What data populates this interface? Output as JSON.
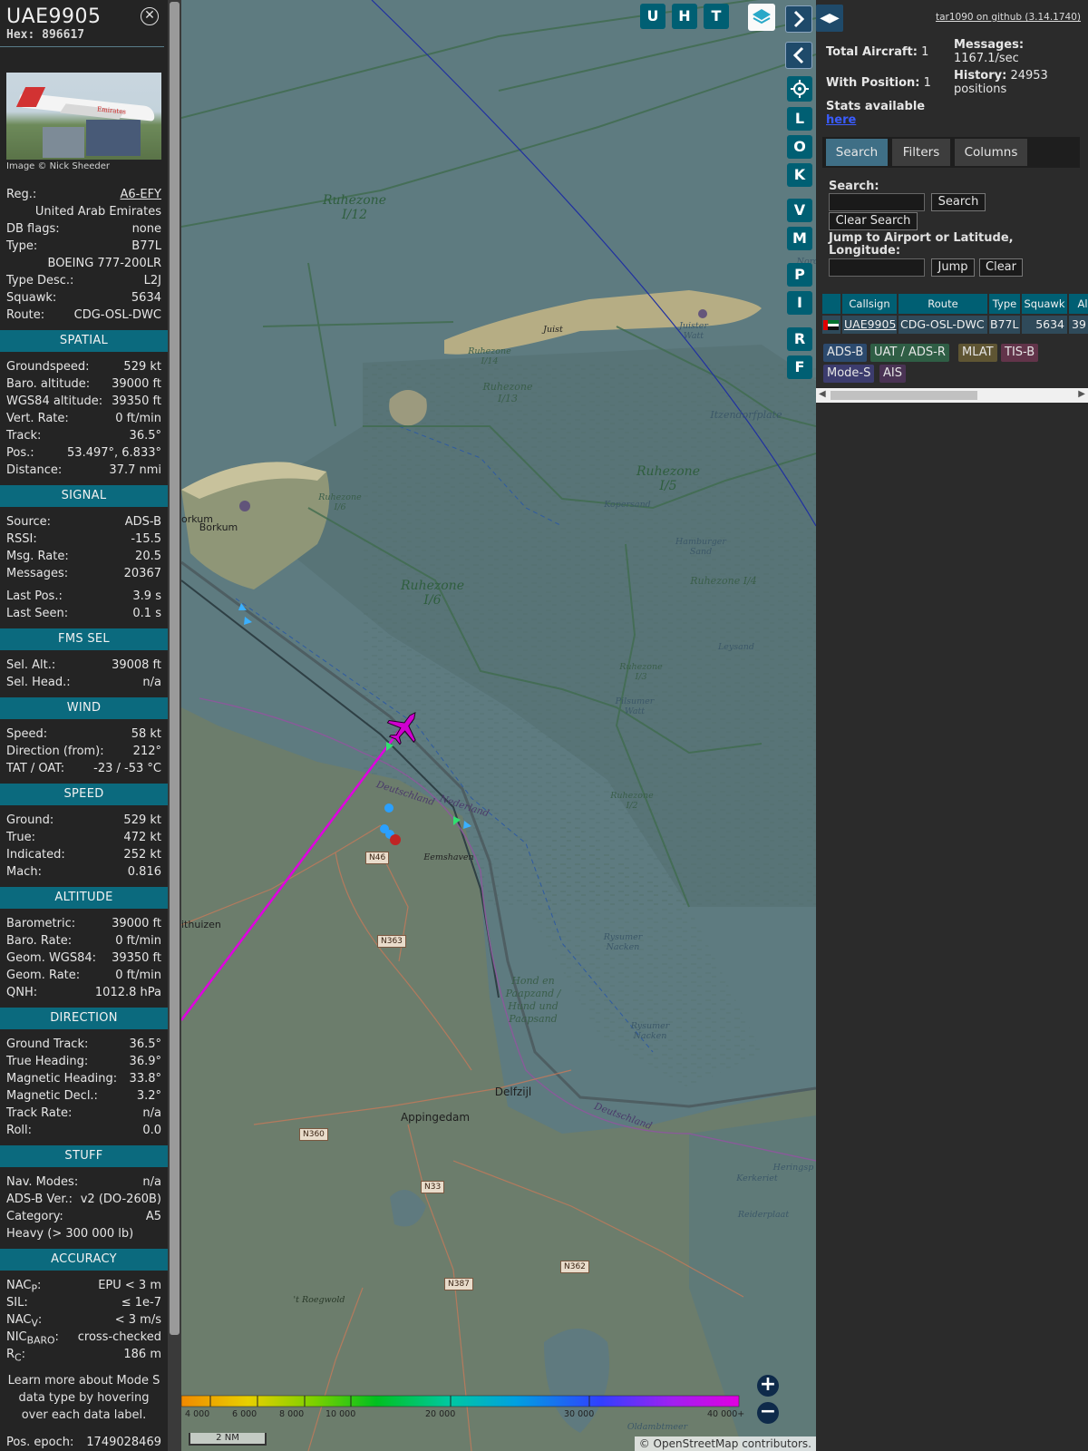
{
  "aircraft": {
    "callsign": "UAE9905",
    "hex": "Hex: 896617",
    "image_credit": "Image © Nick Sheeder",
    "livery_text": "Emirates"
  },
  "details": [
    {
      "label": "Reg.:",
      "value": "A6-EFY",
      "link": true
    },
    {
      "label": "",
      "value": "United Arab Emirates"
    },
    {
      "label": "DB flags:",
      "value": "none"
    },
    {
      "label": "Type:",
      "value": "B77L"
    },
    {
      "label": "",
      "value": "BOEING 777-200LR"
    },
    {
      "label": "Type Desc.:",
      "value": "L2J"
    },
    {
      "label": "Squawk:",
      "value": "5634"
    },
    {
      "label": "Route:",
      "value": "CDG-OSL-DWC"
    }
  ],
  "sections": [
    {
      "title": "SPATIAL",
      "rows": [
        {
          "label": "Groundspeed:",
          "value": "529 kt"
        },
        {
          "label": "Baro. altitude:",
          "value": "39000 ft"
        },
        {
          "label": "WGS84 altitude:",
          "value": "39350 ft"
        },
        {
          "label": "Vert. Rate:",
          "value": "0 ft/min"
        },
        {
          "label": "Track:",
          "value": "36.5°"
        },
        {
          "label": "Pos.:",
          "value": "53.497°, 6.833°"
        },
        {
          "label": "Distance:",
          "value": "37.7 nmi"
        }
      ]
    },
    {
      "title": "SIGNAL",
      "rows": [
        {
          "label": "Source:",
          "value": "ADS-B"
        },
        {
          "label": "RSSI:",
          "value": "-15.5"
        },
        {
          "label": "Msg. Rate:",
          "value": "20.5"
        },
        {
          "label": "Messages:",
          "value": "20367"
        },
        {
          "label": "Last Pos.:",
          "value": "3.9 s",
          "gap": true
        },
        {
          "label": "Last Seen:",
          "value": "0.1 s"
        }
      ]
    },
    {
      "title": "FMS SEL",
      "rows": [
        {
          "label": "Sel. Alt.:",
          "value": "39008 ft"
        },
        {
          "label": "Sel. Head.:",
          "value": "n/a"
        }
      ]
    },
    {
      "title": "WIND",
      "rows": [
        {
          "label": "Speed:",
          "value": "58 kt"
        },
        {
          "label": "Direction (from):",
          "value": "212°"
        },
        {
          "label": "TAT / OAT:",
          "value": "-23 / -53 °C"
        }
      ]
    },
    {
      "title": "SPEED",
      "rows": [
        {
          "label": "Ground:",
          "value": "529 kt"
        },
        {
          "label": "True:",
          "value": "472 kt"
        },
        {
          "label": "Indicated:",
          "value": "252 kt"
        },
        {
          "label": "Mach:",
          "value": "0.816"
        }
      ]
    },
    {
      "title": "ALTITUDE",
      "rows": [
        {
          "label": "Barometric:",
          "value": "39000 ft"
        },
        {
          "label": "Baro. Rate:",
          "value": "0 ft/min"
        },
        {
          "label": "Geom. WGS84:",
          "value": "39350 ft"
        },
        {
          "label": "Geom. Rate:",
          "value": "0 ft/min"
        },
        {
          "label": "QNH:",
          "value": "1012.8 hPa"
        }
      ]
    },
    {
      "title": "DIRECTION",
      "rows": [
        {
          "label": "Ground Track:",
          "value": "36.5°"
        },
        {
          "label": "True Heading:",
          "value": "36.9°"
        },
        {
          "label": "Magnetic Heading:",
          "value": "33.8°"
        },
        {
          "label": "Magnetic Decl.:",
          "value": "3.2°"
        },
        {
          "label": "Track Rate:",
          "value": "n/a"
        },
        {
          "label": "Roll:",
          "value": "0.0"
        }
      ]
    },
    {
      "title": "STUFF",
      "rows": [
        {
          "label": "Nav. Modes:",
          "value": "n/a"
        },
        {
          "label": "ADS-B Ver.:",
          "value": "v2 (DO-260B)"
        },
        {
          "label": "Category:",
          "value": "A5"
        },
        {
          "label": "Heavy (> 300 000 lb)",
          "value": ""
        }
      ]
    },
    {
      "title": "ACCURACY",
      "rows": [
        {
          "label": "NACP:",
          "value": "EPU < 3 m",
          "html_label": "NAC<sub>P</sub>:"
        },
        {
          "label": "SIL:",
          "value": "≤ 1e-7"
        },
        {
          "label": "NACV:",
          "value": "< 3 m/s",
          "html_label": "NAC<sub>V</sub>:"
        },
        {
          "label": "NICBARO:",
          "value": "cross-checked",
          "html_label": "NIC<sub>BARO</sub>:"
        },
        {
          "label": "RC:",
          "value": "186 m",
          "html_label": "R<sub>C</sub>:"
        }
      ]
    }
  ],
  "learn_more": "Learn more about Mode S data type by hovering over each data label.",
  "pos_epoch": {
    "label": "Pos. epoch:",
    "value": "1749028469"
  },
  "map": {
    "top_buttons": [
      "U",
      "H",
      "T"
    ],
    "side_buttons": [
      "L",
      "O",
      "K",
      "V",
      "M",
      "P",
      "I",
      "R",
      "F"
    ],
    "labels": {
      "ruhezone_i12": "Ruhezone I/12",
      "ruhezone_i6": "Ruhezone I/6",
      "ruhezone_i5": "Ruhezone I/5",
      "ruhezone_i4": "Ruhezone I/4",
      "ruhezone_i14": "Ruhezone I/14",
      "ruhezone_i13": "Ruhezone I/13",
      "ruhezone_i6_small": "Ruhezone I/6",
      "ruhezone_i3": "Ruhezone I/3",
      "ruhezone_i2": "Ruhezone I/2",
      "juist": "Juist",
      "juister_watt": "Juister Watt",
      "itzendorfplate": "Itzendorfplate",
      "kopersand": "Kopersand",
      "hamburger_sand": "Hamburger Sand",
      "leysand": "Leysand",
      "pilsumer_watt": "Pilsumer Watt",
      "borkum_a": "orkum",
      "borkum": "Borkum",
      "deutschland": "Deutschland",
      "nederland": "Nederland",
      "eemshaven": "Eemshaven",
      "rysumer_nacken": "Rysumer Nacken",
      "rysumer_nacken2": "Rysumer Nacken",
      "hond_paap": "Hond en Paapzand / Hund und Paapsand",
      "delfzijl": "Delfzijl",
      "appingedam": "Appingedam",
      "uithuizen": "ithuizen",
      "deutschland2": "Deutschland",
      "roegwold": "'t Roegwold",
      "nord": "Nord",
      "kerkeriet": "Kerkeriet",
      "heringsp": "Heringsp",
      "reiderplaat": "Reiderplaat",
      "oldambtmeer": "Oldambtmeer"
    },
    "roads": {
      "n46": "N46",
      "n363": "N363",
      "n360": "N360",
      "n33": "N33",
      "n362": "N362",
      "n387": "N387"
    },
    "color_bar_labels": [
      "4 000",
      "6 000",
      "8 000",
      "10 000",
      "20 000",
      "30 000",
      "40 000+"
    ],
    "scale": "2 NM",
    "attribution_a": "© ",
    "attribution_link": "OpenStreetMap",
    "attribution_b": " contributors."
  },
  "right": {
    "github": "tar1090 on github (3.14.1740)",
    "total_aircraft_label": "Total Aircraft:",
    "total_aircraft": "1",
    "with_position_label": "With Position:",
    "with_position": "1",
    "messages_label": "Messages:",
    "messages": "1167.1/sec",
    "history_label": "History:",
    "history_a": "24953",
    "history_b": "positions",
    "stats_label": "Stats available",
    "stats_link": "here",
    "tabs": [
      "Search",
      "Filters",
      "Columns"
    ],
    "search_label": "Search:",
    "search_button": "Search",
    "clear_search_button": "Clear Search",
    "jump_label": "Jump to Airport or Latitude, Longitude:",
    "jump_button": "Jump",
    "clear_button": "Clear",
    "table_headers": [
      "Callsign",
      "Route",
      "Type",
      "Squawk",
      "Al"
    ],
    "table_row": {
      "callsign": "UAE9905",
      "route": "CDG-OSL-DWC",
      "type": "B77L",
      "squawk": "5634",
      "alt": "39"
    },
    "legend": [
      {
        "label": "ADS-B",
        "color": "#2c4a6e"
      },
      {
        "label": "UAT / ADS-R",
        "color": "#2f5e45"
      },
      {
        "label": "MLAT",
        "color": "#5f5533"
      },
      {
        "label": "TIS-B",
        "color": "#62344a"
      },
      {
        "label": "Mode-S",
        "color": "#3c3c6e"
      },
      {
        "label": "AIS",
        "color": "#4a3354"
      }
    ]
  },
  "colors": {
    "accent": "#005f73",
    "track": "#e000e0",
    "aircraft": "#d000d0"
  }
}
